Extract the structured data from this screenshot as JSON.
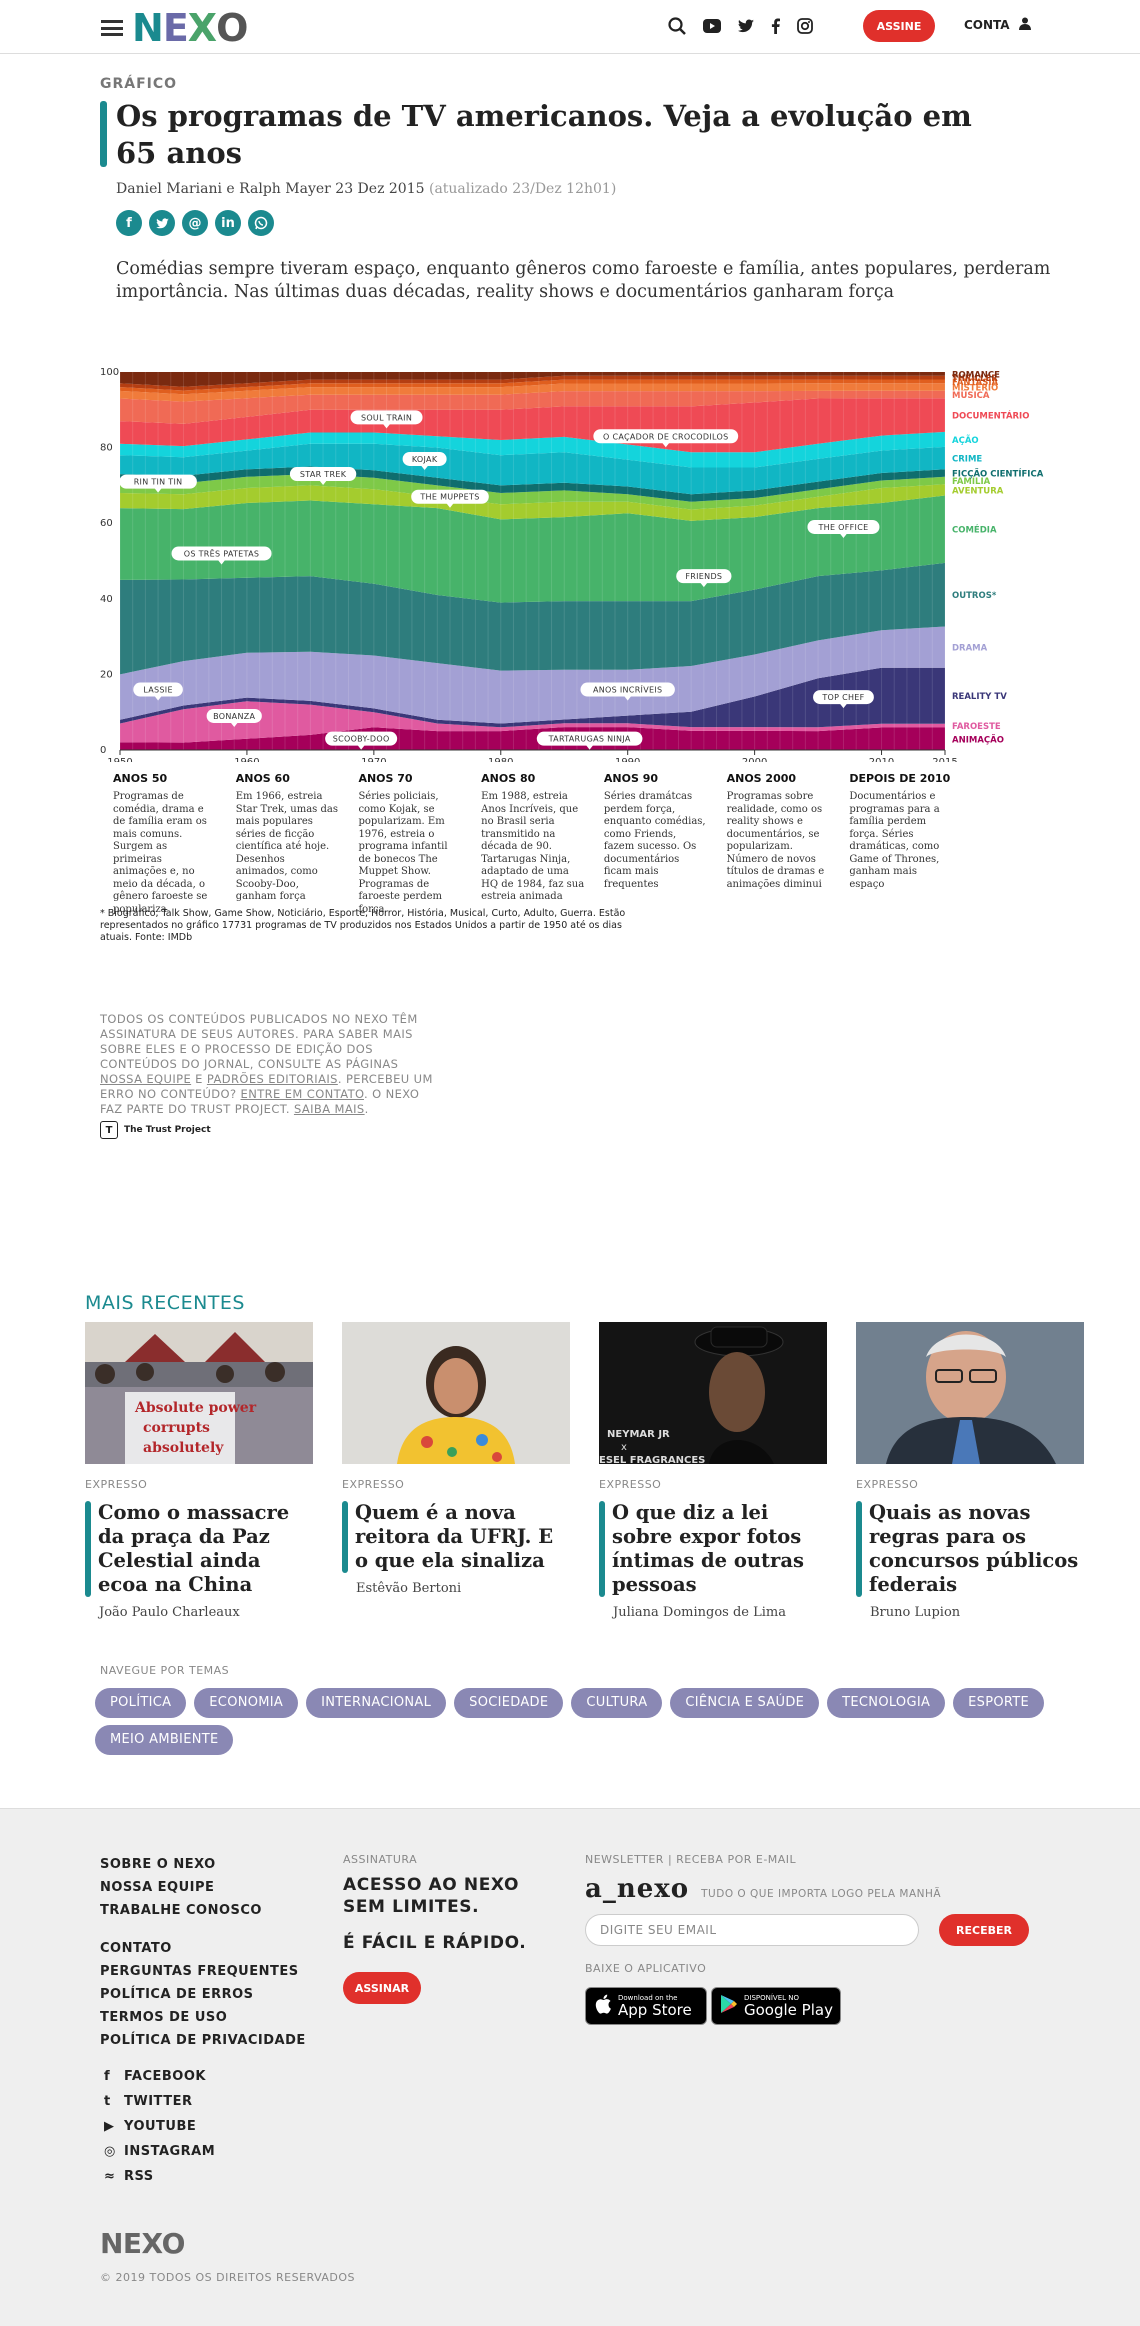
{
  "header": {
    "logo": "NEXO",
    "assine_label": "ASSINE",
    "conta_label": "CONTA"
  },
  "article": {
    "kicker": "GRÁFICO",
    "title": "Os programas de TV americanos. Veja a evolução em 65 anos",
    "authors": "Daniel Mariani e Ralph Mayer 23 Dez 2015",
    "updated": "(atualizado 23/Dez 12h01)",
    "lead": "Comédias sempre tiveram espaço, enquanto gêneros como faroeste e família, antes populares, perderam importância. Nas últimas duas décadas, reality shows e documentários ganharam força"
  },
  "chart_data": {
    "type": "area",
    "title": "",
    "xlabel": "",
    "ylabel": "",
    "ylim": [
      0,
      100
    ],
    "y_ticks": [
      "0",
      "20",
      "40",
      "60",
      "80",
      "100"
    ],
    "x_ticks": [
      "1950",
      "1960",
      "1970",
      "1980",
      "1990",
      "2000",
      "2010",
      "2015"
    ],
    "xlim": [
      1950,
      2015
    ],
    "x": [
      1950,
      1955,
      1960,
      1965,
      1970,
      1975,
      1980,
      1985,
      1990,
      1995,
      2000,
      2005,
      2010,
      2015
    ],
    "series": [
      {
        "name": "ANIMAÇÃO",
        "color": "#a5005a",
        "values": [
          2,
          2,
          3,
          4,
          6,
          5,
          5,
          6,
          6,
          5,
          5,
          5,
          6,
          6
        ]
      },
      {
        "name": "FAROESTE",
        "color": "#e05aa0",
        "values": [
          5,
          9,
          10,
          8,
          4,
          2,
          1,
          1,
          1,
          1,
          1,
          1,
          1,
          1
        ]
      },
      {
        "name": "REALITY TV",
        "color": "#3a3778",
        "values": [
          1,
          1,
          1,
          1,
          1,
          1,
          1,
          1,
          2,
          4,
          8,
          13,
          15,
          15
        ]
      },
      {
        "name": "DRAMA",
        "color": "#a3a0d4",
        "values": [
          12,
          12,
          12,
          13,
          14,
          15,
          14,
          13,
          12,
          12,
          11,
          10,
          10,
          11
        ]
      },
      {
        "name": "OUTROS*",
        "color": "#2e7d7d",
        "values": [
          25,
          22,
          20,
          20,
          19,
          18,
          18,
          18,
          18,
          17,
          17,
          17,
          16,
          17
        ]
      },
      {
        "name": "COMÉDIA",
        "color": "#47b36a",
        "values": [
          19,
          19,
          20,
          20,
          21,
          23,
          22,
          22,
          23,
          21,
          19,
          18,
          18,
          18
        ]
      },
      {
        "name": "AVENTURA",
        "color": "#a4cc2e",
        "values": [
          4,
          4,
          4,
          4,
          4,
          3,
          4,
          4,
          3,
          3,
          3,
          3,
          4,
          3
        ]
      },
      {
        "name": "FAMÍLIA",
        "color": "#7ec948",
        "values": [
          3,
          3,
          3,
          3,
          3,
          3,
          3,
          3,
          2,
          2,
          2,
          2,
          2,
          2
        ]
      },
      {
        "name": "FICÇÃO CIENTÍFICA",
        "color": "#0f6e6e",
        "values": [
          2,
          2,
          2,
          2,
          2,
          2,
          2,
          2,
          2,
          2,
          2,
          2,
          2,
          2
        ]
      },
      {
        "name": "CRIME",
        "color": "#11b6c4",
        "values": [
          5,
          5,
          5,
          6,
          7,
          8,
          8,
          8,
          7,
          7,
          6,
          6,
          6,
          6
        ]
      },
      {
        "name": "AÇÃO",
        "color": "#14d4dc",
        "values": [
          3,
          3,
          3,
          3,
          3,
          3,
          4,
          4,
          4,
          4,
          4,
          4,
          4,
          4
        ]
      },
      {
        "name": "DOCUMENTÁRIO",
        "color": "#ef4a55",
        "values": [
          6,
          6,
          6,
          6,
          6,
          7,
          8,
          8,
          10,
          12,
          13,
          12,
          10,
          9
        ]
      },
      {
        "name": "MÚSICA",
        "color": "#f06a55",
        "values": [
          6,
          6,
          5,
          4,
          4,
          4,
          4,
          4,
          4,
          4,
          3,
          2,
          2,
          2
        ]
      },
      {
        "name": "MISTÉRIO",
        "color": "#f07b3b",
        "values": [
          2,
          2,
          2,
          2,
          2,
          2,
          2,
          2,
          2,
          2,
          2,
          2,
          2,
          2
        ]
      },
      {
        "name": "FANTASIA",
        "color": "#e05e1e",
        "values": [
          1,
          1,
          1,
          1,
          1,
          1,
          1,
          1,
          1,
          1,
          1,
          1,
          1,
          1
        ]
      },
      {
        "name": "THRILLER",
        "color": "#b53e12",
        "values": [
          1,
          1,
          1,
          1,
          1,
          1,
          1,
          1,
          1,
          1,
          1,
          1,
          1,
          1
        ]
      },
      {
        "name": "ROMANCE",
        "color": "#7a2a10",
        "values": [
          3,
          4,
          3,
          2,
          2,
          2,
          2,
          1,
          1,
          1,
          1,
          1,
          1,
          1
        ]
      }
    ],
    "annotations": [
      {
        "label": "SOUL TRAIN",
        "x": 1971,
        "y": 88
      },
      {
        "label": "O CAÇADOR DE CROCODILOS",
        "x": 1993,
        "y": 83
      },
      {
        "label": "RIN TIN TIN",
        "x": 1953,
        "y": 71
      },
      {
        "label": "STAR TREK",
        "x": 1966,
        "y": 73
      },
      {
        "label": "KOJAK",
        "x": 1974,
        "y": 77
      },
      {
        "label": "THE MUPPETS",
        "x": 1976,
        "y": 67
      },
      {
        "label": "THE OFFICE",
        "x": 2007,
        "y": 59
      },
      {
        "label": "OS TRÊS PATETAS",
        "x": 1958,
        "y": 52
      },
      {
        "label": "FRIENDS",
        "x": 1996,
        "y": 46
      },
      {
        "label": "LASSIE",
        "x": 1953,
        "y": 16
      },
      {
        "label": "ANOS INCRÍVEIS",
        "x": 1990,
        "y": 16
      },
      {
        "label": "TOP CHEF",
        "x": 2007,
        "y": 14
      },
      {
        "label": "BONANZA",
        "x": 1959,
        "y": 9
      },
      {
        "label": "SCOOBY-DOO",
        "x": 1969,
        "y": 3
      },
      {
        "label": "TARTARUGAS NINJA",
        "x": 1987,
        "y": 3
      }
    ]
  },
  "decades": [
    {
      "label": "ANOS 50",
      "text": "Programas de comédia, drama e de família eram os mais comuns. Surgem as primeiras animações e, no meio da década, o gênero faroeste se populariza"
    },
    {
      "label": "ANOS 60",
      "text": "Em 1966, estreia Star Trek, umas das mais populares séries de ficção científica até hoje. Desenhos animados, como Scooby-Doo, ganham força"
    },
    {
      "label": "ANOS 70",
      "text": "Séries policiais, como Kojak, se popularizam. Em 1976, estreia o programa infantil de bonecos The Muppet Show. Programas de faroeste perdem força"
    },
    {
      "label": "ANOS 80",
      "text": "Em 1988, estreia Anos Incríveis, que no Brasil seria transmitido na década de 90. Tartarugas Ninja, adaptado de uma HQ de 1984, faz sua estreia animada"
    },
    {
      "label": "ANOS 90",
      "text": "Séries dramátcas perdem força, enquanto comédias, como Friends, fazem sucesso. Os documentários ficam mais frequentes"
    },
    {
      "label": "ANOS 2000",
      "text": "Programas sobre realidade, como os reality shows e documentários, se popularizam. Número de novos títulos de dramas e animações diminui"
    },
    {
      "label": "DEPOIS DE 2010",
      "text": "Documentários e programas para a família perdem força. Séries dramáticas, como Game of Thrones, ganham mais espaço"
    }
  ],
  "footnote": "* Biográfico, Talk Show, Game Show, Noticiário, Esporte, Horror, História, Musical, Curto, Adulto, Guerra. Estão representados no gráfico 17731 programas de TV produzidos nos Estados Unidos a partir de 1950 até os dias atuais. Fonte: IMDb",
  "legal": {
    "p1": "Todos os conteúdos publicados no Nexo têm assinatura de seus autores. Para saber mais sobre eles e o processo de edição dos conteúdos do jornal, consulte as páginas ",
    "link_equipe": "Nossa equipe",
    "and": " e ",
    "link_padroes": "Padrões editoriais",
    "p2": ". Percebeu um erro no conteúdo? ",
    "link_contato": "Entre em contato",
    "p3": ". O Nexo faz parte do Trust Project. ",
    "link_saiba": "Saiba mais",
    "p4": ".",
    "trust_label": "The Trust Project"
  },
  "recentes": {
    "title": "MAIS RECENTES",
    "cards": [
      {
        "section": "EXPRESSO",
        "headline": "Como o massacre da praça da Paz Celestial ainda ecoa na China",
        "author": "João Paulo Charleaux",
        "photo_text": "Absolute power corrupts absolutely"
      },
      {
        "section": "EXPRESSO",
        "headline": "Quem é a nova reitora da UFRJ. E o que ela sinaliza",
        "author": "Estêvão Bertoni"
      },
      {
        "section": "EXPRESSO",
        "headline": "O que diz a lei sobre expor fotos íntimas de outras pessoas",
        "author": "Juliana Domingos de Lima",
        "photo_text": "NEYMAR JR x ESEL FRAGRANCES"
      },
      {
        "section": "EXPRESSO",
        "headline": "Quais as novas regras para os concursos públicos federais",
        "author": "Bruno Lupion"
      }
    ]
  },
  "temas": {
    "label": "NAVEGUE POR TEMAS",
    "items": [
      "POLÍTICA",
      "ECONOMIA",
      "INTERNACIONAL",
      "SOCIEDADE",
      "CULTURA",
      "CIÊNCIA E SAÚDE",
      "TECNOLOGIA",
      "ESPORTE",
      "MEIO AMBIENTE"
    ]
  },
  "footer": {
    "links1": [
      "SOBRE O NEXO",
      "NOSSA EQUIPE",
      "TRABALHE CONOSCO"
    ],
    "links2": [
      "CONTATO",
      "PERGUNTAS FREQUENTES",
      "POLÍTICA DE ERROS",
      "TERMOS DE USO",
      "POLÍTICA DE PRIVACIDADE"
    ],
    "social": [
      "FACEBOOK",
      "TWITTER",
      "YOUTUBE",
      "INSTAGRAM",
      "RSS"
    ],
    "assinatura_label": "ASSINATURA",
    "assinatura_big1": "ACESSO AO NEXO SEM LIMITES.",
    "assinatura_big2": "É FÁCIL E RÁPIDO.",
    "assinar_label": "ASSINAR",
    "newsletter_label": "NEWSLETTER | RECEBA POR E-MAIL",
    "anexo": "a_nexo",
    "anexo_tag": "TUDO O QUE IMPORTA LOGO PELA MANHÃ",
    "email_placeholder": "DIGITE SEU EMAIL",
    "receber_label": "RECEBER",
    "app_label": "BAIXE O APLICATIVO",
    "appstore_small": "Download on the",
    "appstore_big": "App Store",
    "gplay_small": "DISPONÍVEL NO",
    "gplay_big": "Google Play",
    "logo": "NEXO",
    "copyright": "© 2019 TODOS OS DIREITOS RESERVADOS"
  }
}
